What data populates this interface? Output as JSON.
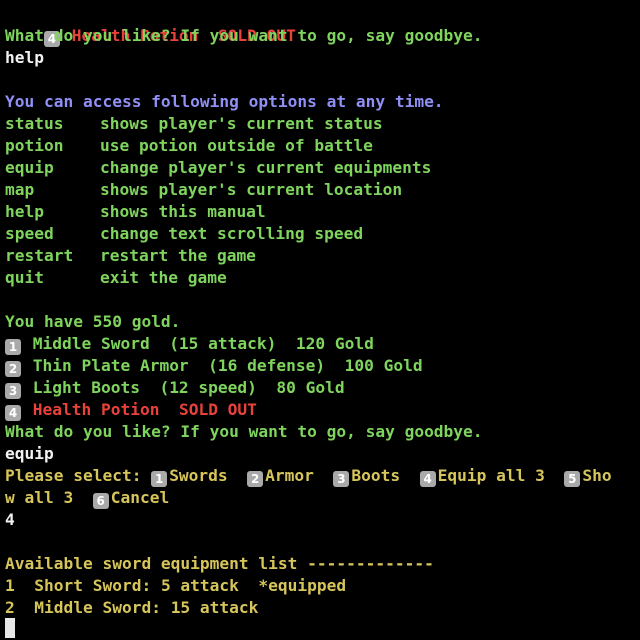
{
  "theme": {
    "green": "#7fd45e",
    "red": "#e8423a",
    "blue": "#8f8ff5",
    "yellow": "#d6c55a",
    "keycap": "#a9a9a9"
  },
  "icons": {
    "keycap": "keycap-digit-icon"
  },
  "top_potion": {
    "key": "4",
    "name": "Health Potion",
    "status": "SOLD OUT"
  },
  "prompt1": "What do you like? If you want to go, say goodbye.",
  "input_help": "help",
  "help_header": "You can access following options at any time.",
  "help_rows": [
    {
      "cmd": "status",
      "desc": "shows player's current status"
    },
    {
      "cmd": "potion",
      "desc": "use potion outside of battle"
    },
    {
      "cmd": "equip",
      "desc": "change player's current equipments"
    },
    {
      "cmd": "map",
      "desc": "shows player's current location"
    },
    {
      "cmd": "help",
      "desc": "shows this manual"
    },
    {
      "cmd": "speed",
      "desc": "change text scrolling speed"
    },
    {
      "cmd": "restart",
      "desc": "restart the game"
    },
    {
      "cmd": "quit",
      "desc": "exit the game"
    }
  ],
  "gold_text": "You have 550 gold.",
  "shop_items": [
    {
      "key": "1",
      "text": "Middle Sword  (15 attack)  120 Gold"
    },
    {
      "key": "2",
      "text": "Thin Plate Armor  (16 defense)  100 Gold"
    },
    {
      "key": "3",
      "text": "Light Boots  (12 speed)  80 Gold"
    }
  ],
  "potion_item": {
    "key": "4",
    "name": "Health Potion",
    "status": "SOLD OUT"
  },
  "prompt2": "What do you like? If you want to go, say goodbye.",
  "input_equip": "equip",
  "select_label": "Please select: ",
  "select_options": [
    {
      "key": "1",
      "label": "Swords"
    },
    {
      "key": "2",
      "label": "Armor"
    },
    {
      "key": "3",
      "label": "Boots"
    },
    {
      "key": "4",
      "label": "Equip all 3"
    },
    {
      "key": "5",
      "label": "Sho"
    }
  ],
  "select_wrap": "w all 3",
  "select_cancel": {
    "key": "6",
    "label": "Cancel"
  },
  "input_4": "4",
  "sword_header": "Available sword equipment list -------------",
  "swords": [
    {
      "num": "1",
      "text": "Short Sword: 5 attack  *equipped"
    },
    {
      "num": "2",
      "text": "Middle Sword: 15 attack"
    }
  ]
}
